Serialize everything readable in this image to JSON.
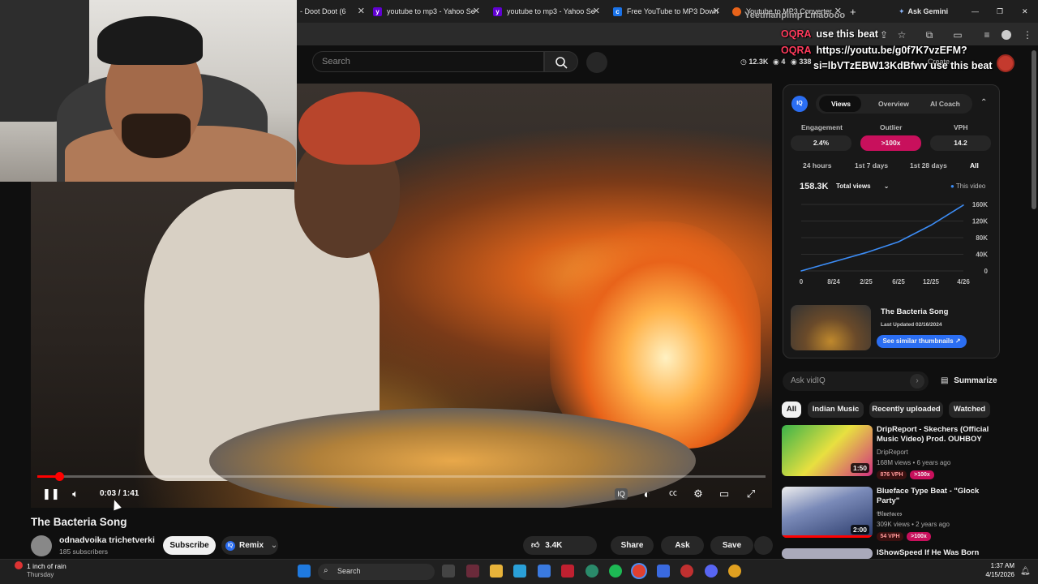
{
  "browser": {
    "tabs": [
      {
        "title": "- Doot Doot (6",
        "icon": "yt-red"
      },
      {
        "title": "youtube to mp3 - Yahoo Se",
        "icon": "yahoo"
      },
      {
        "title": "youtube to mp3 - Yahoo Se",
        "icon": "yahoo"
      },
      {
        "title": "Free YouTube to MP3 Down",
        "icon": "cc"
      },
      {
        "title": "Youtube to MP3 Converter",
        "icon": "orange-circle"
      }
    ],
    "ask_gemini": "Ask Gemini"
  },
  "chat": {
    "header": "Yeetmanpimp  Lmaoooo",
    "messages": [
      {
        "name": "OQRA",
        "text": "use this beat"
      },
      {
        "name": "OQRA",
        "text": "https://youtu.be/g0f7K7vzEFM?"
      },
      {
        "name": "",
        "text": "si=lbVTzEBW13KdBfwv use this beat"
      }
    ]
  },
  "header": {
    "search_placeholder": "Search",
    "stats": [
      "12.3K",
      "4",
      "338"
    ],
    "create_label": "Create"
  },
  "player": {
    "time": "0:03 / 1:41",
    "progress_fraction": 0.03
  },
  "video": {
    "title": "The Bacteria Song",
    "channel": "odnadvoika trichetverki",
    "subscribers": "185 subscribers",
    "subscribe_label": "Subscribe",
    "remix_label": "Remix",
    "likes": "3.4K",
    "share_label": "Share",
    "ask_label": "Ask",
    "save_label": "Save"
  },
  "vidiq": {
    "tabs": [
      "Views",
      "Overview",
      "AI Coach"
    ],
    "metrics": [
      {
        "label": "Engagement",
        "value": "2.4%"
      },
      {
        "label": "Outlier",
        "value": ">100x"
      },
      {
        "label": "VPH",
        "value": "14.2"
      }
    ],
    "ranges": [
      "24 hours",
      "1st 7 days",
      "1st 28 days",
      "All"
    ],
    "total": "158.3K",
    "metric_select": "Total views",
    "legend": "This video",
    "thumb_title": "The Bacteria Song",
    "last_updated": "Last Updated 02/16/2024",
    "similar_button": "See similar thumbnails",
    "ask_placeholder": "Ask vidIQ",
    "summarize_label": "Summarize"
  },
  "chart_data": {
    "type": "line",
    "x": [
      "0",
      "8/24",
      "2/25",
      "6/25",
      "12/25",
      "4/26"
    ],
    "y_ticks": [
      "0",
      "40K",
      "80K",
      "120K",
      "160K"
    ],
    "series": [
      {
        "name": "This video",
        "values": [
          0,
          22000,
          44000,
          70000,
          110000,
          158300
        ]
      }
    ],
    "ylim": [
      0,
      160000
    ]
  },
  "filters": [
    "All",
    "Indian Music",
    "Recently uploaded",
    "Watched"
  ],
  "recommendations": [
    {
      "title": "DripReport - Skechers (Official Music Video) Prod. OUHBOY",
      "channel": "DripReport",
      "meta": "168M views • 6 years ago",
      "vph": "876 VPH",
      "outlier": ">100x",
      "duration": "1:50"
    },
    {
      "title": "Blueface Type Beat - \"Glock Party\"",
      "channel": "𝕭𝖑𝖚𝖊𝖋𝖆𝖈𝖊𝖘",
      "meta": "309K views • 2 years ago",
      "vph": "54 VPH",
      "outlier": ">100x",
      "duration": "2:00"
    },
    {
      "title": "IShowSpeed If He Was Born",
      "channel": "",
      "meta": "",
      "vph": "",
      "outlier": "",
      "duration": ""
    }
  ],
  "taskbar": {
    "weather": "1 inch of rain",
    "weather_day": "Thursday",
    "search_label": "Search",
    "time": "1:37 AM",
    "date": "4/15/2026"
  },
  "colors": {
    "accent": "#ff0000",
    "vidiq_blue": "#2b6ef2",
    "outlier_pink": "#c8105c"
  }
}
